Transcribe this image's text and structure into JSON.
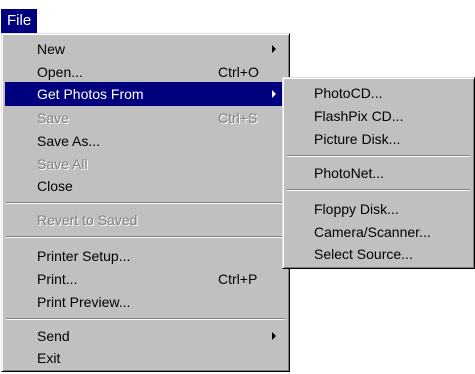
{
  "menubar": {
    "file": "File"
  },
  "file_menu": {
    "new": "New",
    "open": "Open...",
    "open_shortcut": "Ctrl+O",
    "get_photos_from": "Get Photos From",
    "save": "Save",
    "save_shortcut": "Ctrl+S",
    "save_as": "Save As...",
    "save_all": "Save All",
    "close": "Close",
    "revert_to_saved": "Revert to Saved",
    "printer_setup": "Printer Setup...",
    "print": "Print...",
    "print_shortcut": "Ctrl+P",
    "print_preview": "Print Preview...",
    "send": "Send",
    "exit": "Exit"
  },
  "get_photos_submenu": {
    "photo_cd": "PhotoCD...",
    "flashpix_cd": "FlashPix CD...",
    "picture_disk": "Picture Disk...",
    "photonet": "PhotoNet...",
    "floppy_disk": "Floppy Disk...",
    "camera_scanner": "Camera/Scanner...",
    "select_source": "Select Source..."
  }
}
